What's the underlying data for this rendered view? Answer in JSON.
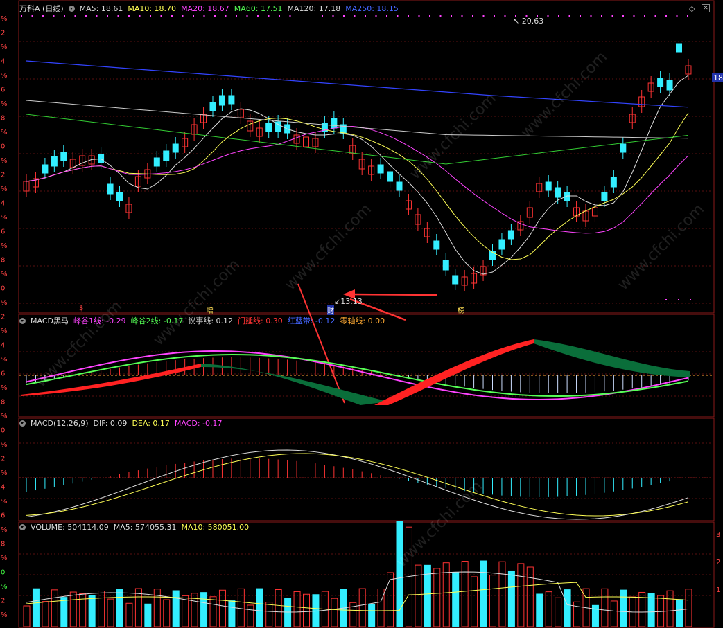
{
  "header": {
    "stock": "万科A",
    "period": "(日线)",
    "ma": [
      {
        "text": "MA5: 18.61",
        "color": "#dddddd"
      },
      {
        "text": "MA10: 18.70",
        "color": "#ffff55"
      },
      {
        "text": "MA20: 18.67",
        "color": "#ff44ff"
      },
      {
        "text": "MA60: 17.51",
        "color": "#55ff55"
      },
      {
        "text": "MA120: 17.18",
        "color": "#dddddd"
      },
      {
        "text": "MA250: 18.15",
        "color": "#4466ff"
      }
    ]
  },
  "price_panel": {
    "high_label": "20.63",
    "low_label": "13.13",
    "right_axis_value": "18",
    "markers": [
      "$",
      "增",
      "财",
      "榜"
    ]
  },
  "macd_hm": {
    "title": "MACD黑马",
    "items": [
      {
        "text": "峰谷1线: -0.29",
        "color": "#ff44ff"
      },
      {
        "text": "峰谷2线: -0.17",
        "color": "#55ff55"
      },
      {
        "text": "议事线: 0.12",
        "color": "#dddddd"
      },
      {
        "text": "门延线: 0.30",
        "color": "#ff3333"
      },
      {
        "text": "红蓝带: -0.12",
        "color": "#4466ff"
      },
      {
        "text": "零轴线: 0.00",
        "color": "#ffaa33"
      }
    ]
  },
  "macd": {
    "title": "MACD(12,26,9)",
    "items": [
      {
        "text": "DIF: 0.09",
        "color": "#dddddd"
      },
      {
        "text": "DEA: 0.17",
        "color": "#ffff55"
      },
      {
        "text": "MACD: -0.17",
        "color": "#ff44ff"
      }
    ]
  },
  "volume": {
    "title": "VOLUME: 504114.09",
    "items": [
      {
        "text": "MA5: 574055.31",
        "color": "#dddddd"
      },
      {
        "text": "MA10: 580051.00",
        "color": "#ffff55"
      }
    ]
  },
  "watermark": "www.cfchi.com",
  "colors": {
    "up": "#ff3333",
    "down": "#33eeff",
    "bg": "#000000"
  }
}
